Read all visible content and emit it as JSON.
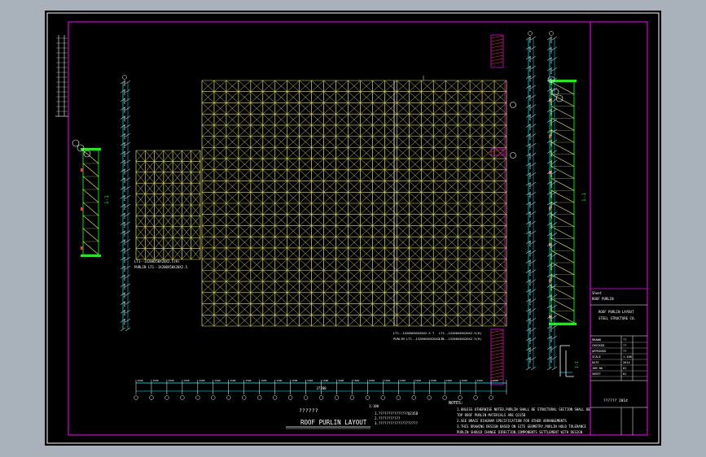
{
  "drawing": {
    "title_cn": "??????",
    "title_en": "ROOF PURLIN LAYOUT",
    "scale_note": "1:100",
    "notes_heading": "NOTES:",
    "notes": [
      "1.UNLESS OTHERWISE NOTED,PURLIN SHALL BE STRUCTURAL SECTION SHALL BE",
      "  TOP ROOF PURLIN MATERIALS ARE Q235B",
      "2.SEE BRACE DIAGRAM SPECIFICATION FOR OTHER ARRANGEMENTS",
      "3.THIS DRAWING DESIGN BASED ON SITE GEOMETRY,PURLIN HOLD TOLERANCE",
      "  PURLIN SHOULD CHANGE DIRECTION,COMPONENTS SETTLEMENT WITH DESIGN"
    ],
    "legend_lines": [
      "1.???????????????Q235B",
      "2.???????????",
      "3.????????????????????"
    ],
    "overall_dimension": "37200",
    "bay_dimensions": [
      "1500",
      "1500",
      "1500",
      "1500",
      "1500",
      "1500",
      "1500",
      "1500",
      "1500",
      "1500",
      "1500",
      "1500",
      "1500",
      "1500",
      "1500",
      "1500",
      "1500",
      "1500",
      "1500",
      "1500",
      "1500",
      "1500",
      "1500",
      "1500"
    ],
    "member_labels": {
      "left_panel": [
        "LT1--1X200X50X20X2.5(H)",
        "PURLIN LT1--1X200X50X20X2.5"
      ],
      "main_bottom_left": [
        "LT1--1X200X50X20X2.5 T",
        "PURLIN LT1--1X200X50X20X2.5"
      ],
      "main_bottom_right": [
        "LT1--1X200X50X20X2.5(H)",
        "LT1--1X200X50X20X2.5(H)"
      ]
    },
    "section_labels": {
      "left": "1-1",
      "right": "1-1",
      "detail": "1-1"
    }
  },
  "title_block": {
    "header": "Sheet",
    "rows": [
      [
        "DRAWN",
        "??"
      ],
      [
        "CHECKED",
        "??"
      ],
      [
        "APPROVED",
        "??"
      ],
      [
        "SCALE",
        "1:100"
      ],
      [
        "DATE",
        "2014"
      ],
      [
        "JOB NO",
        "01"
      ],
      [
        "SHEET",
        "01"
      ]
    ],
    "project": "ROOF PURLIN",
    "drawing_name": "ROOF PURLIN LAYOUT",
    "company": "STEEL STRUCTURE CO.",
    "stamp": "?????? 2014"
  },
  "colors": {
    "background": "#000000",
    "outer_frame": "#ffffff",
    "inner_frame": "#ff00ff",
    "purlin": "#e7e35a",
    "brace": "#f0f060",
    "green": "#00ff00",
    "axis": "#ffffff",
    "dim": "#00ffff",
    "red": "#ff3030"
  },
  "appearance": {
    "grid_cols": 25,
    "grid_rows": 22
  }
}
